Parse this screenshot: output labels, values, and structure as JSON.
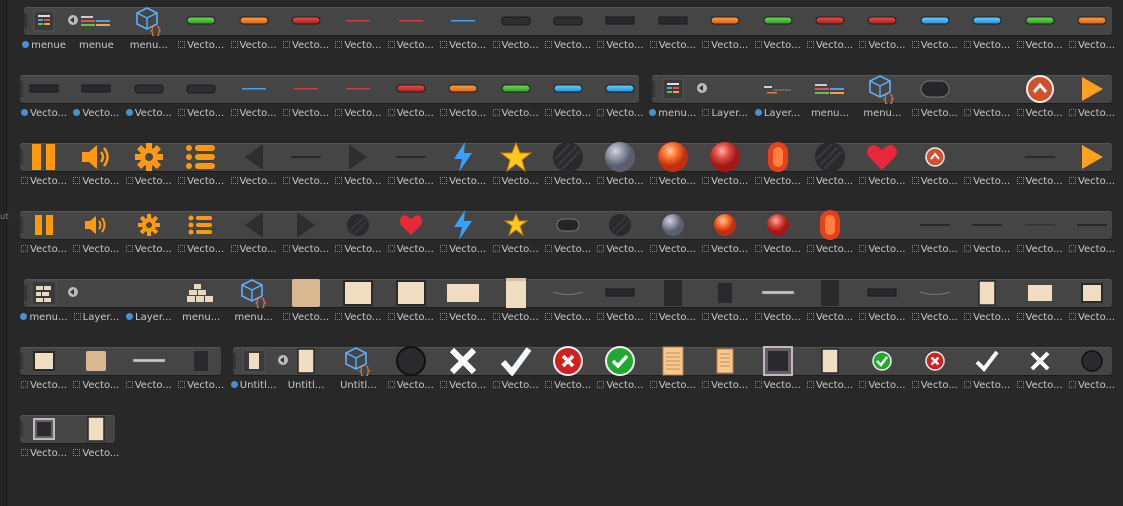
{
  "panel": {
    "edge_label": "ut"
  },
  "rows": [
    {
      "strips": [
        [
          24,
          1112
        ]
      ],
      "cells": [
        {
          "label": "menue",
          "icon": "menu-prefab-icon",
          "tag": "blue",
          "expand": true
        },
        {
          "label": "menue",
          "icon": "menu-bars-icon",
          "tag": "none"
        },
        {
          "label": "menu...",
          "icon": "cube-script-icon",
          "tag": "none"
        },
        {
          "label": "Vecto...",
          "icon": "pill-green-icon",
          "tag": "vec"
        },
        {
          "label": "Vecto...",
          "icon": "pill-orange-icon",
          "tag": "vec"
        },
        {
          "label": "Vecto...",
          "icon": "pill-red-icon",
          "tag": "vec"
        },
        {
          "label": "Vecto...",
          "icon": "line-red-icon",
          "tag": "vec"
        },
        {
          "label": "Vecto...",
          "icon": "line-red-icon",
          "tag": "vec"
        },
        {
          "label": "Vecto...",
          "icon": "line-blue-icon",
          "tag": "vec"
        },
        {
          "label": "Vecto...",
          "icon": "pill-dark-icon",
          "tag": "vec"
        },
        {
          "label": "Vecto...",
          "icon": "pill-dark-icon",
          "tag": "vec"
        },
        {
          "label": "Vecto...",
          "icon": "bar-dark-icon",
          "tag": "vec"
        },
        {
          "label": "Vecto...",
          "icon": "bar-dark-icon",
          "tag": "vec"
        },
        {
          "label": "Vecto...",
          "icon": "pill-orange-icon",
          "tag": "vec"
        },
        {
          "label": "Vecto...",
          "icon": "pill-green-icon",
          "tag": "vec"
        },
        {
          "label": "Vecto...",
          "icon": "pill-red-icon",
          "tag": "vec"
        },
        {
          "label": "Vecto...",
          "icon": "pill-red-icon",
          "tag": "vec"
        },
        {
          "label": "Vecto...",
          "icon": "pill-blue-icon",
          "tag": "vec"
        },
        {
          "label": "Vecto...",
          "icon": "pill-blue-icon",
          "tag": "vec"
        },
        {
          "label": "Vecto...",
          "icon": "pill-green-icon",
          "tag": "vec"
        },
        {
          "label": "Vecto...",
          "icon": "pill-orange-icon",
          "tag": "vec"
        }
      ]
    },
    {
      "strips": [
        [
          20,
          639
        ],
        [
          652,
          1112
        ]
      ],
      "cells": [
        {
          "label": "Vecto...",
          "icon": "bar-dark-icon",
          "tag": "blue"
        },
        {
          "label": "Vecto...",
          "icon": "bar-dark-icon",
          "tag": "blue"
        },
        {
          "label": "Vecto...",
          "icon": "pill-dark-icon",
          "tag": "blue"
        },
        {
          "label": "Vecto...",
          "icon": "pill-dark-icon",
          "tag": "vec"
        },
        {
          "label": "Vecto...",
          "icon": "line-blue-icon",
          "tag": "vec"
        },
        {
          "label": "Vecto...",
          "icon": "line-red-icon",
          "tag": "vec"
        },
        {
          "label": "Vecto...",
          "icon": "line-red-icon",
          "tag": "vec"
        },
        {
          "label": "Vecto...",
          "icon": "pill-red-icon",
          "tag": "vec"
        },
        {
          "label": "Vecto...",
          "icon": "pill-orange-icon",
          "tag": "vec"
        },
        {
          "label": "Vecto...",
          "icon": "pill-green-icon",
          "tag": "vec"
        },
        {
          "label": "Vecto...",
          "icon": "pill-blue-icon",
          "tag": "vec"
        },
        {
          "label": "Vecto...",
          "icon": "pill-blue-icon",
          "tag": "vec"
        },
        {
          "label": "menu...",
          "icon": "menu-prefab-icon",
          "tag": "blue",
          "expand": true
        },
        {
          "label": "Layer...",
          "icon": "blank-icon",
          "tag": "vec"
        },
        {
          "label": "Layer...",
          "icon": "layer-small-icon",
          "tag": "blue"
        },
        {
          "label": "menu...",
          "icon": "menu-bars-icon",
          "tag": "none"
        },
        {
          "label": "menu...",
          "icon": "cube-script-icon",
          "tag": "none"
        },
        {
          "label": "Vecto...",
          "icon": "capsule-dark-icon",
          "tag": "vec"
        },
        {
          "label": "Vecto...",
          "icon": "blank-icon",
          "tag": "vec"
        },
        {
          "label": "Vecto...",
          "icon": "round-up-button-icon",
          "tag": "vec"
        },
        {
          "label": "Vecto...",
          "icon": "play-icon",
          "tag": "vec"
        }
      ]
    },
    {
      "strips": [
        [
          20,
          1112
        ]
      ],
      "cells": [
        {
          "label": "Vecto...",
          "icon": "pause-icon",
          "tag": "vec"
        },
        {
          "label": "Vecto...",
          "icon": "speaker-icon",
          "tag": "vec"
        },
        {
          "label": "Vecto...",
          "icon": "gear-icon",
          "tag": "vec"
        },
        {
          "label": "Vecto...",
          "icon": "list-icon",
          "tag": "vec"
        },
        {
          "label": "Vecto...",
          "icon": "arrow-left-dark-icon",
          "tag": "vec"
        },
        {
          "label": "Vecto...",
          "icon": "dash-dark-icon",
          "tag": "vec"
        },
        {
          "label": "Vecto...",
          "icon": "arrow-right-dark-icon",
          "tag": "vec"
        },
        {
          "label": "Vecto...",
          "icon": "dash-dark-icon",
          "tag": "vec"
        },
        {
          "label": "Vecto...",
          "icon": "lightning-icon",
          "tag": "vec"
        },
        {
          "label": "Vecto...",
          "icon": "star-icon",
          "tag": "vec"
        },
        {
          "label": "Vecto...",
          "icon": "circle-dark-icon",
          "tag": "vec"
        },
        {
          "label": "Vecto...",
          "icon": "circle-gray-icon",
          "tag": "vec"
        },
        {
          "label": "Vecto...",
          "icon": "circle-orange-icon",
          "tag": "vec"
        },
        {
          "label": "Vecto...",
          "icon": "circle-red-icon",
          "tag": "vec"
        },
        {
          "label": "Vecto...",
          "icon": "capsule-red-icon",
          "tag": "vec"
        },
        {
          "label": "Vecto...",
          "icon": "circle-dark-icon",
          "tag": "vec"
        },
        {
          "label": "Vecto...",
          "icon": "heart-icon",
          "tag": "vec"
        },
        {
          "label": "Vecto...",
          "icon": "round-up-button-small-icon",
          "tag": "vec"
        },
        {
          "label": "Vecto...",
          "icon": "blank-icon",
          "tag": "vec"
        },
        {
          "label": "Vecto...",
          "icon": "dash-dark-icon",
          "tag": "vec"
        },
        {
          "label": "Vecto...",
          "icon": "play-icon",
          "tag": "vec"
        }
      ]
    },
    {
      "strips": [
        [
          20,
          1112
        ]
      ],
      "cells": [
        {
          "label": "Vecto...",
          "icon": "pause-small-icon",
          "tag": "vec"
        },
        {
          "label": "Vecto...",
          "icon": "speaker-small-icon",
          "tag": "vec"
        },
        {
          "label": "Vecto...",
          "icon": "gear-small-icon",
          "tag": "vec"
        },
        {
          "label": "Vecto...",
          "icon": "list-small-icon",
          "tag": "vec"
        },
        {
          "label": "Vecto...",
          "icon": "arrow-left-dark-icon",
          "tag": "vec"
        },
        {
          "label": "Vecto...",
          "icon": "arrow-right-dark-icon",
          "tag": "vec"
        },
        {
          "label": "Vecto...",
          "icon": "circle-dark-small-icon",
          "tag": "vec"
        },
        {
          "label": "Vecto...",
          "icon": "heart-small-icon",
          "tag": "vec"
        },
        {
          "label": "Vecto...",
          "icon": "lightning-icon",
          "tag": "vec"
        },
        {
          "label": "Vecto...",
          "icon": "star-small-icon",
          "tag": "vec"
        },
        {
          "label": "Vecto...",
          "icon": "capsule-dark-small-icon",
          "tag": "vec"
        },
        {
          "label": "Vecto...",
          "icon": "circle-dark-small-icon",
          "tag": "vec"
        },
        {
          "label": "Vecto...",
          "icon": "circle-gray-small-icon",
          "tag": "vec"
        },
        {
          "label": "Vecto...",
          "icon": "circle-orange-small-icon",
          "tag": "vec"
        },
        {
          "label": "Vecto...",
          "icon": "circle-red-small-icon",
          "tag": "vec"
        },
        {
          "label": "Vecto...",
          "icon": "capsule-red-icon",
          "tag": "vec"
        },
        {
          "label": "Vecto...",
          "icon": "blank-icon",
          "tag": "vec"
        },
        {
          "label": "Vecto...",
          "icon": "dash-dark-icon",
          "tag": "vec"
        },
        {
          "label": "Vecto...",
          "icon": "dash-dark-icon",
          "tag": "vec"
        },
        {
          "label": "Vecto...",
          "icon": "line-gray-icon",
          "tag": "vec"
        },
        {
          "label": "Vecto...",
          "icon": "dash-dark-icon",
          "tag": "vec"
        }
      ]
    },
    {
      "strips": [
        [
          24,
          1112
        ]
      ],
      "cells": [
        {
          "label": "menu...",
          "icon": "bricks-prefab-icon",
          "tag": "blue",
          "expand": true
        },
        {
          "label": "Layer...",
          "icon": "blank-icon",
          "tag": "vec"
        },
        {
          "label": "Layer...",
          "icon": "blank-icon",
          "tag": "blue"
        },
        {
          "label": "menu...",
          "icon": "bricks-icon",
          "tag": "none"
        },
        {
          "label": "menu...",
          "icon": "cube-script-icon",
          "tag": "none"
        },
        {
          "label": "Vecto...",
          "icon": "paper-square-icon",
          "tag": "vec"
        },
        {
          "label": "Vecto...",
          "icon": "paper-frame-icon",
          "tag": "vec"
        },
        {
          "label": "Vecto...",
          "icon": "paper-frame-icon",
          "tag": "vec"
        },
        {
          "label": "Vecto...",
          "icon": "paper-wide-icon",
          "tag": "vec"
        },
        {
          "label": "Vecto...",
          "icon": "scroll-icon",
          "tag": "vec"
        },
        {
          "label": "Vecto...",
          "icon": "wave-line-icon",
          "tag": "vec"
        },
        {
          "label": "Vecto...",
          "icon": "bar-dark-icon",
          "tag": "vec"
        },
        {
          "label": "Vecto...",
          "icon": "dark-tall-icon",
          "tag": "vec"
        },
        {
          "label": "Vecto...",
          "icon": "dark-small-icon",
          "tag": "vec"
        },
        {
          "label": "Vecto...",
          "icon": "line-gray-thick-icon",
          "tag": "vec"
        },
        {
          "label": "Vecto...",
          "icon": "dark-tall-icon",
          "tag": "vec"
        },
        {
          "label": "Vecto...",
          "icon": "bar-dark-icon",
          "tag": "vec"
        },
        {
          "label": "Vecto...",
          "icon": "wave-line-icon",
          "tag": "vec"
        },
        {
          "label": "Vecto...",
          "icon": "scroll-small-icon",
          "tag": "vec"
        },
        {
          "label": "Vecto...",
          "icon": "paper-small-icon",
          "tag": "vec"
        },
        {
          "label": "Vecto...",
          "icon": "paper-frame-small-icon",
          "tag": "vec"
        }
      ]
    },
    {
      "strips": [
        [
          20,
          221
        ],
        [
          233,
          1112
        ]
      ],
      "cells": [
        {
          "label": "Vecto...",
          "icon": "paper-frame-small-icon",
          "tag": "vec"
        },
        {
          "label": "Vecto...",
          "icon": "paper-square-small-icon",
          "tag": "vec"
        },
        {
          "label": "Vecto...",
          "icon": "line-gray-thick-icon",
          "tag": "vec"
        },
        {
          "label": "Vecto...",
          "icon": "dark-small-icon",
          "tag": "vec"
        },
        {
          "label": "Untitl...",
          "icon": "paper-prefab-icon",
          "tag": "blue",
          "expand": true
        },
        {
          "label": "Untitl...",
          "icon": "scroll-small-icon",
          "tag": "none"
        },
        {
          "label": "Untitl...",
          "icon": "cube-script-icon",
          "tag": "none"
        },
        {
          "label": "Vecto...",
          "icon": "circle-outline-dark-icon",
          "tag": "vec"
        },
        {
          "label": "Vecto...",
          "icon": "cross-white-icon",
          "tag": "vec"
        },
        {
          "label": "Vecto...",
          "icon": "check-white-icon",
          "tag": "vec"
        },
        {
          "label": "Vecto...",
          "icon": "cross-red-circle-icon",
          "tag": "vec"
        },
        {
          "label": "Vecto...",
          "icon": "check-green-circle-icon",
          "tag": "vec"
        },
        {
          "label": "Vecto...",
          "icon": "note-paper-icon",
          "tag": "vec"
        },
        {
          "label": "Vecto...",
          "icon": "note-paper-small-icon",
          "tag": "vec"
        },
        {
          "label": "Vecto...",
          "icon": "dark-frame-icon",
          "tag": "vec"
        },
        {
          "label": "Vecto...",
          "icon": "scroll-small-icon",
          "tag": "vec"
        },
        {
          "label": "Vecto...",
          "icon": "check-green-small-icon",
          "tag": "vec"
        },
        {
          "label": "Vecto...",
          "icon": "cross-red-small-icon",
          "tag": "vec"
        },
        {
          "label": "Vecto...",
          "icon": "check-white-small-icon",
          "tag": "vec"
        },
        {
          "label": "Vecto...",
          "icon": "cross-white-small-icon",
          "tag": "vec"
        },
        {
          "label": "Vecto...",
          "icon": "circle-dark-outline-small-icon",
          "tag": "vec"
        }
      ]
    },
    {
      "strips": [
        [
          20,
          115
        ]
      ],
      "cells": [
        {
          "label": "Vecto...",
          "icon": "dark-frame-small-icon",
          "tag": "vec"
        },
        {
          "label": "Vecto...",
          "icon": "scroll-small-icon",
          "tag": "vec"
        }
      ]
    }
  ]
}
